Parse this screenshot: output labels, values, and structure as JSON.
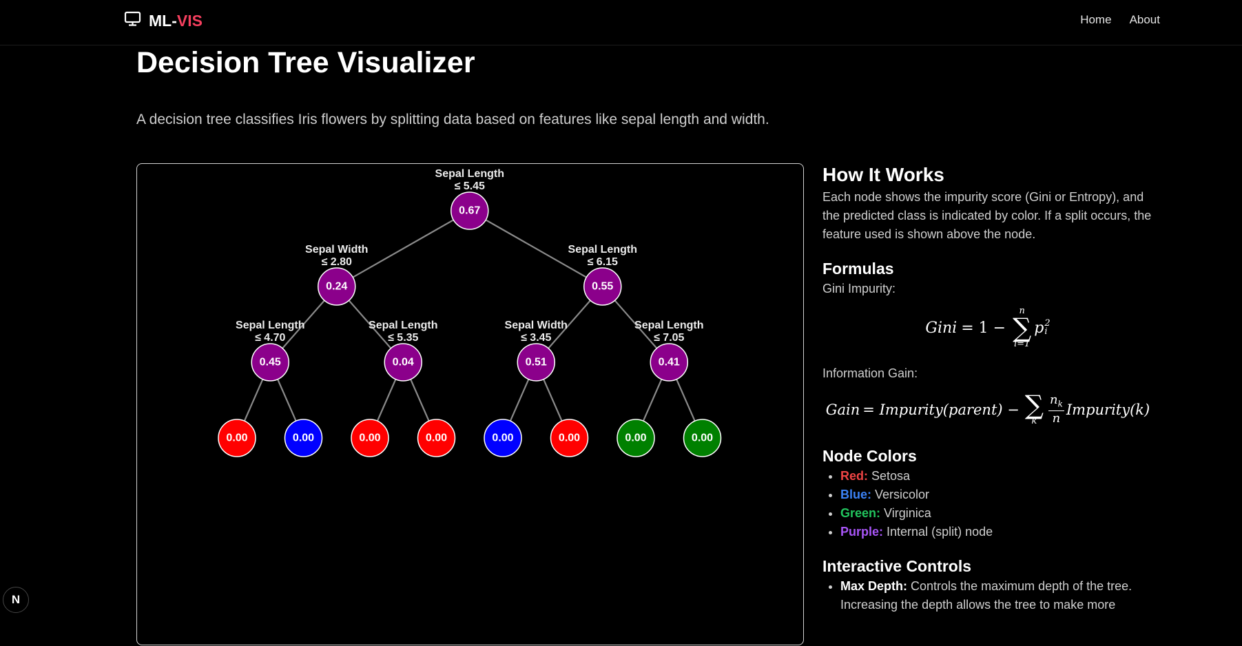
{
  "nav": {
    "brand_prefix": "ML-",
    "brand_accent": "VIS",
    "links": [
      "Home",
      "About"
    ]
  },
  "page": {
    "title": "Decision Tree Visualizer",
    "intro": "A decision tree classifies Iris flowers by splitting data based on features like sepal length and width."
  },
  "tree": {
    "colors": {
      "internal": "#8b008b",
      "setosa": "#ff0000",
      "versicolor": "#0000ff",
      "virginica": "#008000",
      "edge": "#8a8a8a"
    },
    "nodes": [
      {
        "id": "n0",
        "feature": "Sepal Length",
        "threshold": "≤ 5.45",
        "value": "0.67",
        "class": "internal"
      },
      {
        "id": "n1",
        "feature": "Sepal Width",
        "threshold": "≤ 2.80",
        "value": "0.24",
        "class": "internal"
      },
      {
        "id": "n2",
        "feature": "Sepal Length",
        "threshold": "≤ 6.15",
        "value": "0.55",
        "class": "internal"
      },
      {
        "id": "n3",
        "feature": "Sepal Length",
        "threshold": "≤ 4.70",
        "value": "0.45",
        "class": "internal"
      },
      {
        "id": "n4",
        "feature": "Sepal Length",
        "threshold": "≤ 5.35",
        "value": "0.04",
        "class": "internal"
      },
      {
        "id": "n5",
        "feature": "Sepal Width",
        "threshold": "≤ 3.45",
        "value": "0.51",
        "class": "internal"
      },
      {
        "id": "n6",
        "feature": "Sepal Length",
        "threshold": "≤ 7.05",
        "value": "0.41",
        "class": "internal"
      },
      {
        "id": "n7",
        "value": "0.00",
        "class": "setosa"
      },
      {
        "id": "n8",
        "value": "0.00",
        "class": "versicolor"
      },
      {
        "id": "n9",
        "value": "0.00",
        "class": "setosa"
      },
      {
        "id": "n10",
        "value": "0.00",
        "class": "setosa"
      },
      {
        "id": "n11",
        "value": "0.00",
        "class": "versicolor"
      },
      {
        "id": "n12",
        "value": "0.00",
        "class": "setosa"
      },
      {
        "id": "n13",
        "value": "0.00",
        "class": "virginica"
      },
      {
        "id": "n14",
        "value": "0.00",
        "class": "virginica"
      }
    ]
  },
  "sidebar": {
    "how_title": "How It Works",
    "how_text": "Each node shows the impurity score (Gini or Entropy), and the predicted class is indicated by color. If a split occurs, the feature used is shown above the node.",
    "formulas_title": "Formulas",
    "gini_label": "Gini Impurity:",
    "gini_lhs": "Gini",
    "gini_eq": "= 1 −",
    "gini_upper": "n",
    "gini_lower": "i=1",
    "gini_var": "p",
    "gini_sup": "2",
    "gini_sub": "i",
    "gain_label": "Information Gain:",
    "gain_lhs": "Gain",
    "gain_eq": "= Impurity(parent) −",
    "gain_lower": "k",
    "gain_num": "n",
    "gain_num_sub": "k",
    "gain_den": "n",
    "gain_rhs": "Impurity(k)",
    "colors_title": "Node Colors",
    "legend": [
      {
        "name": "Red:",
        "desc": "Setosa"
      },
      {
        "name": "Blue:",
        "desc": "Versicolor"
      },
      {
        "name": "Green:",
        "desc": "Virginica"
      },
      {
        "name": "Purple:",
        "desc": "Internal (split) node"
      }
    ],
    "controls_title": "Interactive Controls",
    "controls": [
      {
        "name": "Max Depth:",
        "desc": "Controls the maximum depth of the tree. Increasing the depth allows the tree to make more"
      }
    ]
  },
  "badge": "N"
}
